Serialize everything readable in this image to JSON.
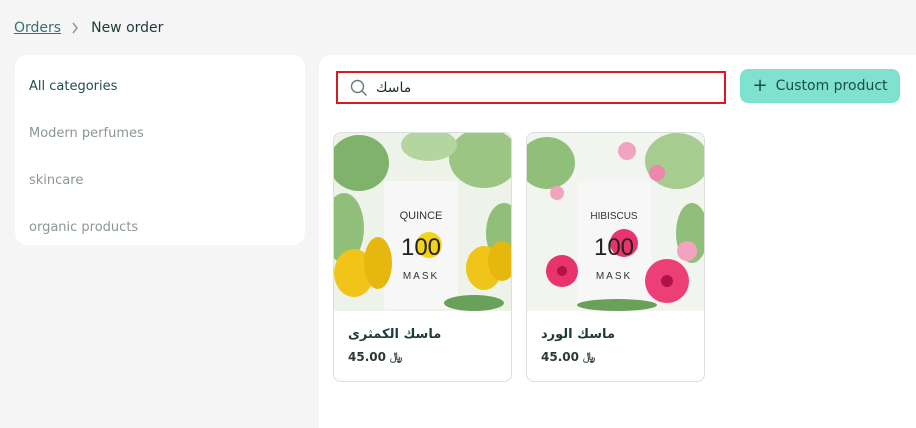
{
  "breadcrumb": {
    "parent": "Orders",
    "current": "New order"
  },
  "sidebar": {
    "items": [
      {
        "label": "All categories",
        "active": true
      },
      {
        "label": "Modern perfumes",
        "active": false
      },
      {
        "label": "skincare",
        "active": false
      },
      {
        "label": "organic products",
        "active": false
      }
    ]
  },
  "search": {
    "value": "ماسك",
    "icon": "search-icon"
  },
  "custom_product": {
    "label": "Custom product",
    "icon": "plus-icon"
  },
  "products": [
    {
      "name": "ماسك الكمثرى",
      "price": "45.00",
      "currency_symbol": "﷼",
      "image_text": {
        "line1": "QUINCE",
        "line2": "100",
        "line3": "MASK"
      },
      "accent": "#f2d21b"
    },
    {
      "name": "ماسك الورد",
      "price": "45.00",
      "currency_symbol": "﷼",
      "image_text": {
        "line1": "HIBISCUS",
        "line2": "100",
        "line3": "MASK"
      },
      "accent": "#e8336d"
    }
  ],
  "colors": {
    "accent_button": "#7ee2cf",
    "search_highlight": "#d81b23",
    "text_primary": "#1e3b3b"
  }
}
